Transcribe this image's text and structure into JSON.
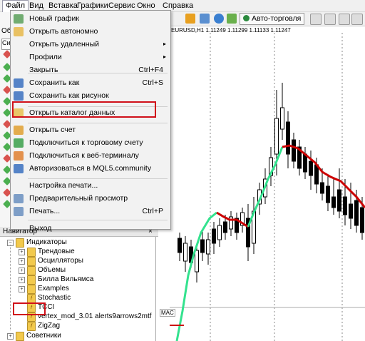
{
  "menubar": {
    "items": [
      "Файл",
      "Вид",
      "Вставка",
      "Графики",
      "Сервис",
      "Окно",
      "Справка"
    ]
  },
  "toolbar": {
    "autotrade_label": "Авто-торговля"
  },
  "left_panel": {
    "tab_label": "Об",
    "symbol_label": "Си"
  },
  "chart": {
    "title": "EURUSD,H1  1.11249 1.11299 1.11133 1.11247",
    "sub_label": "MAC"
  },
  "file_menu": {
    "items": [
      {
        "label": "Новый график",
        "shortcut": "",
        "submenu": false,
        "icon": "new-chart-icon"
      },
      {
        "label": "Открыть автономно",
        "shortcut": "",
        "submenu": false,
        "icon": "open-folder-icon"
      },
      {
        "label": "Открыть удаленный",
        "shortcut": "",
        "submenu": true,
        "icon": ""
      },
      {
        "label": "Профили",
        "shortcut": "",
        "submenu": true,
        "icon": ""
      },
      {
        "label": "Закрыть",
        "shortcut": "Ctrl+F4",
        "submenu": false,
        "icon": ""
      },
      {
        "label": "Сохранить как",
        "shortcut": "Ctrl+S",
        "submenu": false,
        "icon": "save-icon"
      },
      {
        "label": "Сохранить как рисунок",
        "shortcut": "",
        "submenu": false,
        "icon": "save-picture-icon"
      },
      {
        "label": "Открыть каталог данных",
        "shortcut": "",
        "submenu": false,
        "icon": "folder-icon"
      },
      {
        "label": "Открыть счет",
        "shortcut": "",
        "submenu": false,
        "icon": "user-icon"
      },
      {
        "label": "Подключиться к торговому счету",
        "shortcut": "",
        "submenu": false,
        "icon": "user-connect-icon"
      },
      {
        "label": "Подключиться к веб-терминалу",
        "shortcut": "",
        "submenu": false,
        "icon": "web-icon"
      },
      {
        "label": "Авторизоваться в MQL5.community",
        "shortcut": "",
        "submenu": false,
        "icon": "mql5-icon"
      },
      {
        "label": "Настройка печати...",
        "shortcut": "",
        "submenu": false,
        "icon": ""
      },
      {
        "label": "Предварительный просмотр",
        "shortcut": "",
        "submenu": false,
        "icon": "print-preview-icon"
      },
      {
        "label": "Печать...",
        "shortcut": "Ctrl+P",
        "submenu": false,
        "icon": "print-icon"
      },
      {
        "label": "Выход",
        "shortcut": "",
        "submenu": false,
        "icon": ""
      }
    ]
  },
  "navigator": {
    "title": "Навигатор",
    "close": "×",
    "items": [
      {
        "label": "Индикаторы",
        "level": 1,
        "type": "folder",
        "expander": "−"
      },
      {
        "label": "Трендовые",
        "level": 2,
        "type": "folder",
        "expander": "+"
      },
      {
        "label": "Осцилляторы",
        "level": 2,
        "type": "folder",
        "expander": "+"
      },
      {
        "label": "Объемы",
        "level": 2,
        "type": "folder",
        "expander": "+"
      },
      {
        "label": "Билла Вильямса",
        "level": 2,
        "type": "folder",
        "expander": "+"
      },
      {
        "label": "Examples",
        "level": 2,
        "type": "folder",
        "expander": "+"
      },
      {
        "label": "Stochastic",
        "level": 2,
        "type": "indicator",
        "expander": ""
      },
      {
        "label": "TCCI",
        "level": 2,
        "type": "indicator",
        "expander": ""
      },
      {
        "label": "vertex_mod_3.01 alerts9arrows2mtf",
        "level": 2,
        "type": "indicator",
        "expander": ""
      },
      {
        "label": "ZigZag",
        "level": 2,
        "type": "indicator",
        "expander": ""
      },
      {
        "label": "Советники",
        "level": 1,
        "type": "folder",
        "expander": "+"
      }
    ]
  },
  "colors": {
    "highlight": "#d0101a",
    "ma_up": "#33e28e",
    "ma_down": "#cc0000",
    "candle": "#000000"
  }
}
